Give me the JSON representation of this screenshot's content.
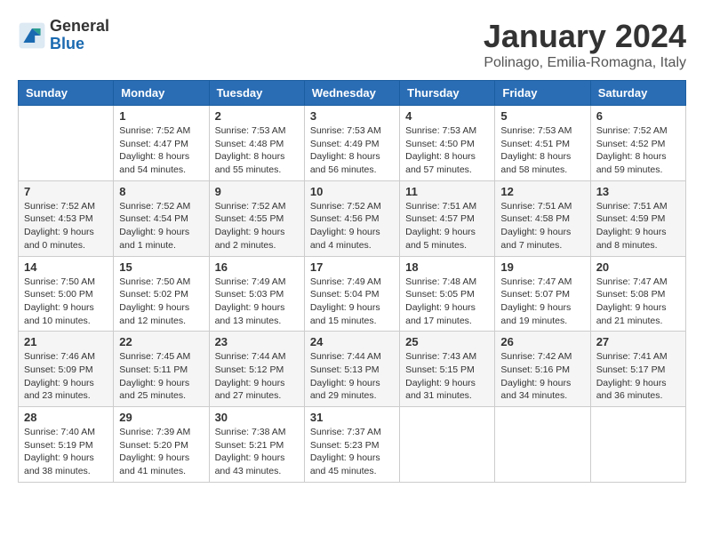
{
  "header": {
    "logo_general": "General",
    "logo_blue": "Blue",
    "month_title": "January 2024",
    "location": "Polinago, Emilia-Romagna, Italy"
  },
  "days_of_week": [
    "Sunday",
    "Monday",
    "Tuesday",
    "Wednesday",
    "Thursday",
    "Friday",
    "Saturday"
  ],
  "weeks": [
    [
      {
        "day": "",
        "info": ""
      },
      {
        "day": "1",
        "info": "Sunrise: 7:52 AM\nSunset: 4:47 PM\nDaylight: 8 hours\nand 54 minutes."
      },
      {
        "day": "2",
        "info": "Sunrise: 7:53 AM\nSunset: 4:48 PM\nDaylight: 8 hours\nand 55 minutes."
      },
      {
        "day": "3",
        "info": "Sunrise: 7:53 AM\nSunset: 4:49 PM\nDaylight: 8 hours\nand 56 minutes."
      },
      {
        "day": "4",
        "info": "Sunrise: 7:53 AM\nSunset: 4:50 PM\nDaylight: 8 hours\nand 57 minutes."
      },
      {
        "day": "5",
        "info": "Sunrise: 7:53 AM\nSunset: 4:51 PM\nDaylight: 8 hours\nand 58 minutes."
      },
      {
        "day": "6",
        "info": "Sunrise: 7:52 AM\nSunset: 4:52 PM\nDaylight: 8 hours\nand 59 minutes."
      }
    ],
    [
      {
        "day": "7",
        "info": "Sunrise: 7:52 AM\nSunset: 4:53 PM\nDaylight: 9 hours\nand 0 minutes."
      },
      {
        "day": "8",
        "info": "Sunrise: 7:52 AM\nSunset: 4:54 PM\nDaylight: 9 hours\nand 1 minute."
      },
      {
        "day": "9",
        "info": "Sunrise: 7:52 AM\nSunset: 4:55 PM\nDaylight: 9 hours\nand 2 minutes."
      },
      {
        "day": "10",
        "info": "Sunrise: 7:52 AM\nSunset: 4:56 PM\nDaylight: 9 hours\nand 4 minutes."
      },
      {
        "day": "11",
        "info": "Sunrise: 7:51 AM\nSunset: 4:57 PM\nDaylight: 9 hours\nand 5 minutes."
      },
      {
        "day": "12",
        "info": "Sunrise: 7:51 AM\nSunset: 4:58 PM\nDaylight: 9 hours\nand 7 minutes."
      },
      {
        "day": "13",
        "info": "Sunrise: 7:51 AM\nSunset: 4:59 PM\nDaylight: 9 hours\nand 8 minutes."
      }
    ],
    [
      {
        "day": "14",
        "info": "Sunrise: 7:50 AM\nSunset: 5:00 PM\nDaylight: 9 hours\nand 10 minutes."
      },
      {
        "day": "15",
        "info": "Sunrise: 7:50 AM\nSunset: 5:02 PM\nDaylight: 9 hours\nand 12 minutes."
      },
      {
        "day": "16",
        "info": "Sunrise: 7:49 AM\nSunset: 5:03 PM\nDaylight: 9 hours\nand 13 minutes."
      },
      {
        "day": "17",
        "info": "Sunrise: 7:49 AM\nSunset: 5:04 PM\nDaylight: 9 hours\nand 15 minutes."
      },
      {
        "day": "18",
        "info": "Sunrise: 7:48 AM\nSunset: 5:05 PM\nDaylight: 9 hours\nand 17 minutes."
      },
      {
        "day": "19",
        "info": "Sunrise: 7:47 AM\nSunset: 5:07 PM\nDaylight: 9 hours\nand 19 minutes."
      },
      {
        "day": "20",
        "info": "Sunrise: 7:47 AM\nSunset: 5:08 PM\nDaylight: 9 hours\nand 21 minutes."
      }
    ],
    [
      {
        "day": "21",
        "info": "Sunrise: 7:46 AM\nSunset: 5:09 PM\nDaylight: 9 hours\nand 23 minutes."
      },
      {
        "day": "22",
        "info": "Sunrise: 7:45 AM\nSunset: 5:11 PM\nDaylight: 9 hours\nand 25 minutes."
      },
      {
        "day": "23",
        "info": "Sunrise: 7:44 AM\nSunset: 5:12 PM\nDaylight: 9 hours\nand 27 minutes."
      },
      {
        "day": "24",
        "info": "Sunrise: 7:44 AM\nSunset: 5:13 PM\nDaylight: 9 hours\nand 29 minutes."
      },
      {
        "day": "25",
        "info": "Sunrise: 7:43 AM\nSunset: 5:15 PM\nDaylight: 9 hours\nand 31 minutes."
      },
      {
        "day": "26",
        "info": "Sunrise: 7:42 AM\nSunset: 5:16 PM\nDaylight: 9 hours\nand 34 minutes."
      },
      {
        "day": "27",
        "info": "Sunrise: 7:41 AM\nSunset: 5:17 PM\nDaylight: 9 hours\nand 36 minutes."
      }
    ],
    [
      {
        "day": "28",
        "info": "Sunrise: 7:40 AM\nSunset: 5:19 PM\nDaylight: 9 hours\nand 38 minutes."
      },
      {
        "day": "29",
        "info": "Sunrise: 7:39 AM\nSunset: 5:20 PM\nDaylight: 9 hours\nand 41 minutes."
      },
      {
        "day": "30",
        "info": "Sunrise: 7:38 AM\nSunset: 5:21 PM\nDaylight: 9 hours\nand 43 minutes."
      },
      {
        "day": "31",
        "info": "Sunrise: 7:37 AM\nSunset: 5:23 PM\nDaylight: 9 hours\nand 45 minutes."
      },
      {
        "day": "",
        "info": ""
      },
      {
        "day": "",
        "info": ""
      },
      {
        "day": "",
        "info": ""
      }
    ]
  ]
}
